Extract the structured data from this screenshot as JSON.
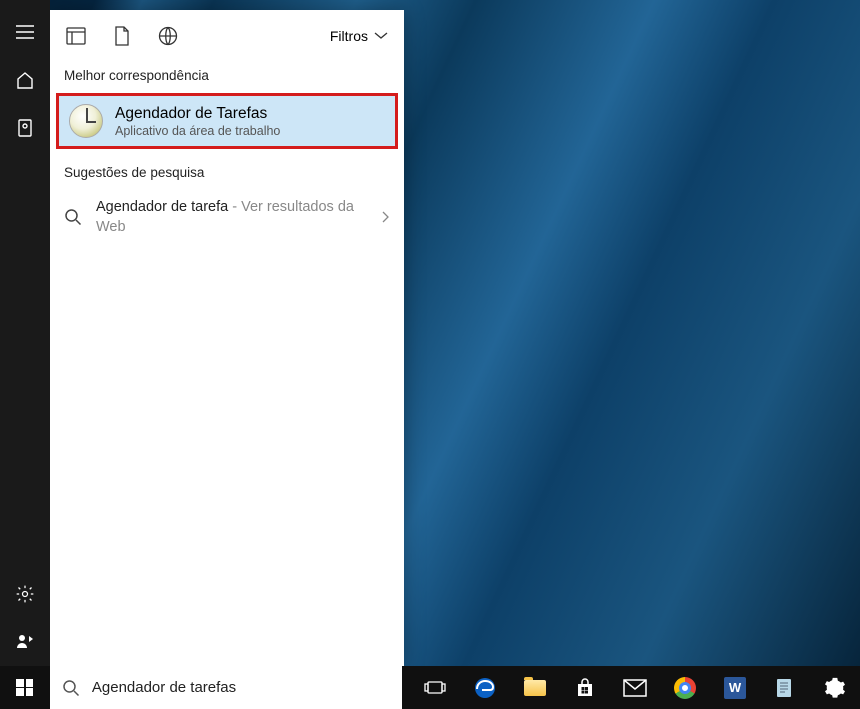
{
  "search": {
    "filters_label": "Filtros",
    "best_match_label": "Melhor correspondência",
    "best_match": {
      "title": "Agendador de Tarefas",
      "subtitle": "Aplicativo da área de trabalho"
    },
    "suggestions_label": "Sugestões de pesquisa",
    "web_suggestion": {
      "query": "Agendador de tarefa",
      "tail": " - Ver resultados da Web"
    },
    "input_value": "Agendador de tarefas"
  }
}
